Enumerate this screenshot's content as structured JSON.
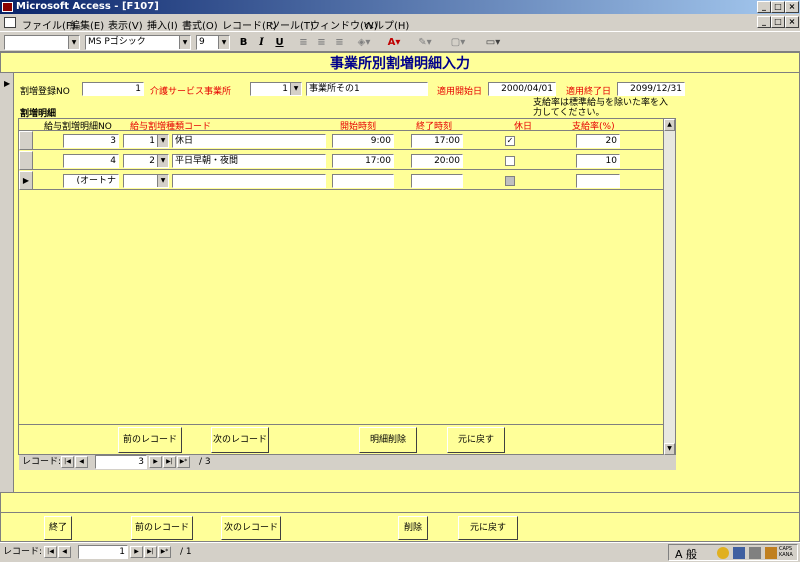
{
  "window": {
    "title": "Microsoft Access - [F107]"
  },
  "menu": [
    "ファイル(F)",
    "編集(E)",
    "表示(V)",
    "挿入(I)",
    "書式(O)",
    "レコード(R)",
    "ツール(T)",
    "ウィンドウ(W)",
    "ヘルプ(H)"
  ],
  "toolbar": {
    "font": "MS Pゴシック",
    "size": "9",
    "bold": "B",
    "italic": "I",
    "underline": "U"
  },
  "form": {
    "title": "事業所別割増明細入力",
    "header": {
      "no_label": "割増登録NO",
      "no_value": "1",
      "office_label": "介護サービス事業所",
      "office_code": "1",
      "office_name": "事業所その1",
      "start_label": "適用開始日",
      "start_value": "2000/04/01",
      "end_label": "適用終了日",
      "end_value": "2099/12/31"
    },
    "note": "支給率は標準給与を除いた率を入力してください。",
    "detail_title": "割増明細",
    "columns": {
      "detail_no": "給与割増明細NO",
      "type_code": "給与割増種類コード",
      "start_time": "開始時刻",
      "end_time": "終了時刻",
      "holiday": "休日",
      "rate": "支給率(%)"
    },
    "rows": [
      {
        "no": "3",
        "code": "1",
        "name": "休日",
        "start": "9:00",
        "end": "17:00",
        "holiday": true,
        "rate": "20"
      },
      {
        "no": "4",
        "code": "2",
        "name": "平日早朝・夜間",
        "start": "17:00",
        "end": "20:00",
        "holiday": false,
        "rate": "10"
      },
      {
        "no": "(オートナ",
        "code": "",
        "name": "",
        "start": "",
        "end": "",
        "holiday": false,
        "rate": ""
      }
    ],
    "sub_buttons": {
      "prev": "前のレコード",
      "next": "次のレコード",
      "delete": "明細削除",
      "undo": "元に戻す"
    },
    "sub_nav": {
      "label": "レコード:",
      "current": "3",
      "total": "/ 3"
    },
    "buttons": {
      "exit": "終了",
      "prev": "前のレコード",
      "next": "次のレコード",
      "delete": "削除",
      "undo": "元に戻す"
    }
  },
  "status": {
    "label": "レコード:",
    "current": "1",
    "total": "/ 1",
    "caps": "CAPS KANA"
  }
}
